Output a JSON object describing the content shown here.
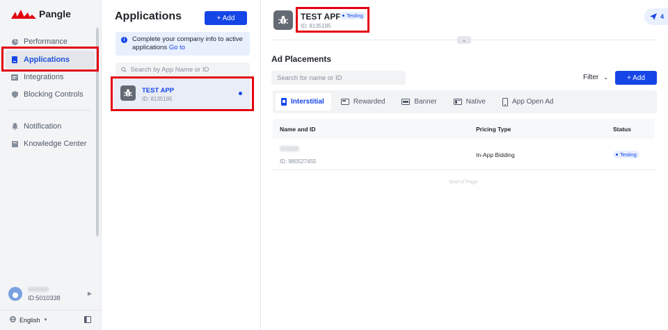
{
  "sidebar": {
    "logo_text": "Pangle",
    "items": [
      {
        "label": "Performance",
        "icon": "pie-chart-icon"
      },
      {
        "label": "Applications",
        "icon": "app-icon"
      },
      {
        "label": "Integrations",
        "icon": "integrations-icon"
      },
      {
        "label": "Blocking Controls",
        "icon": "shield-icon"
      }
    ],
    "secondary_items": [
      {
        "label": "Notification",
        "icon": "bell-icon"
      },
      {
        "label": "Knowledge Center",
        "icon": "book-icon"
      }
    ],
    "user": {
      "id_text": "ID:5010338"
    },
    "language": "English"
  },
  "apps_panel": {
    "title": "Applications",
    "add_label": "+ Add",
    "info_text": "Complete your company info to active applications",
    "info_link": "Go to",
    "search_placeholder": "Search by App Name or ID",
    "apps": [
      {
        "name": "TEST APP",
        "id_text": "ID: 8135185",
        "selected": true
      }
    ]
  },
  "app_header": {
    "name": "TEST APP",
    "status": "Testing",
    "id_text": "ID: 8135185",
    "notification_count": "4"
  },
  "placements": {
    "title": "Ad Placements",
    "search_placeholder": "Search for name or ID",
    "filter_label": "Filter",
    "add_label": "+ Add",
    "tabs": [
      {
        "label": "Interstitial",
        "icon": "interstitial-icon",
        "active": true
      },
      {
        "label": "Rewarded",
        "icon": "rewarded-icon",
        "active": false
      },
      {
        "label": "Banner",
        "icon": "banner-icon",
        "active": false
      },
      {
        "label": "Native",
        "icon": "native-icon",
        "active": false
      },
      {
        "label": "App Open Ad",
        "icon": "phone-icon",
        "active": false
      }
    ],
    "columns": {
      "name": "Name and ID",
      "pricing": "Pricing Type",
      "status": "Status"
    },
    "rows": [
      {
        "id_text": "ID: 980527455",
        "pricing": "In-App Bidding",
        "status": "Testing"
      }
    ],
    "end_text": "End of Page"
  },
  "colors": {
    "accent": "#1545e6",
    "highlight": "#e3000f",
    "logo_red": "#e3000f"
  }
}
